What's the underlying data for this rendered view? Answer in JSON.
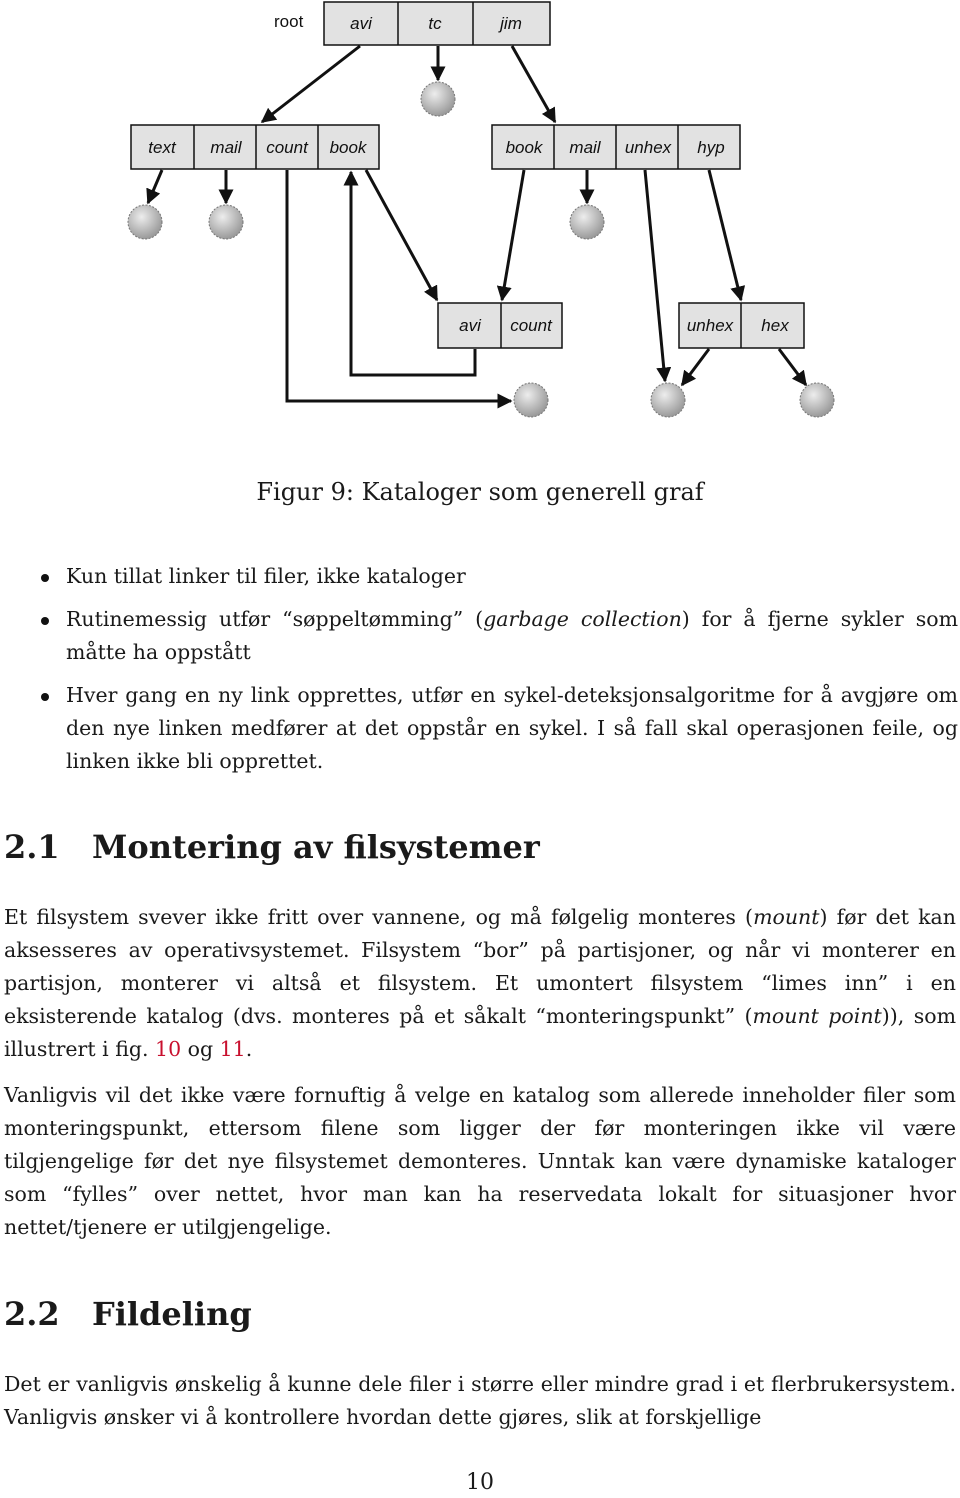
{
  "figure": {
    "root_label": "root",
    "directories": [
      {
        "id": "root",
        "entries": [
          "avi",
          "tc",
          "jim"
        ]
      },
      {
        "id": "avi-dir",
        "entries": [
          "text",
          "mail",
          "count",
          "book"
        ]
      },
      {
        "id": "jim-dir",
        "entries": [
          "book",
          "mail",
          "unhex",
          "hyp"
        ]
      },
      {
        "id": "book-dir",
        "entries": [
          "avi",
          "count"
        ]
      },
      {
        "id": "hyp-dir",
        "entries": [
          "unhex",
          "hex"
        ]
      }
    ],
    "colors": {
      "cell_fill": "#e2e2e2",
      "stroke": "#111111",
      "file_node": "#c4c4c4"
    }
  },
  "caption": "Figur 9: Kataloger som generell graf",
  "bullets": [
    {
      "text": "Kun tillat linker til filer, ikke kataloger"
    },
    {
      "pre": "Rutinemessig utfør “søppeltømming” (",
      "em": "garbage collection",
      "post": ") for å fjerne sykler som måtte ha oppstått"
    },
    {
      "text": "Hver gang en ny link opprettes, utfør en sykel-deteksjonsalgoritme for å avgjøre om den nye linken medfører at det oppstår en sykel. I så fall skal operasjonen feile, og linken ikke bli opprettet."
    }
  ],
  "section_21": {
    "number": "2.1",
    "title": "Montering av filsystemer",
    "p1": {
      "a": "Et filsystem svever ikke fritt over vannene, og må følgelig monteres (",
      "em1": "mount",
      "b": ") før det kan aksesseres av operativsystemet. Filsystem “bor” på partisjoner, og når vi monterer en partisjon, monterer vi altså et filsystem. Et umontert filsystem “limes inn” i en eksisterende katalog (dvs. monteres på et såkalt “monteringspunkt” (",
      "em2": "mount point",
      "c": ")), som illustrert i fig. ",
      "ref1": "10",
      "d": " og ",
      "ref2": "11",
      "e": "."
    },
    "p2": "Vanligvis vil det ikke være fornuftig å velge en katalog som allerede inneholder filer som monteringspunkt, ettersom filene som ligger der før monteringen ikke vil være tilgjengelige før det nye filsystemet demonteres. Unntak kan være dynamiske kataloger som “fylles” over nettet, hvor man kan ha reservedata lokalt for situasjoner hvor nettet/tjenere er utilgjengelige."
  },
  "section_22": {
    "number": "2.2",
    "title": "Fildeling",
    "p1": "Det er vanligvis ønskelig å kunne dele filer i større eller mindre grad i et flerbrukersystem. Vanligvis ønsker vi å kontrollere hvordan dette gjøres, slik at forskjellige"
  },
  "page_number": "10",
  "link_color": "#c8102e"
}
